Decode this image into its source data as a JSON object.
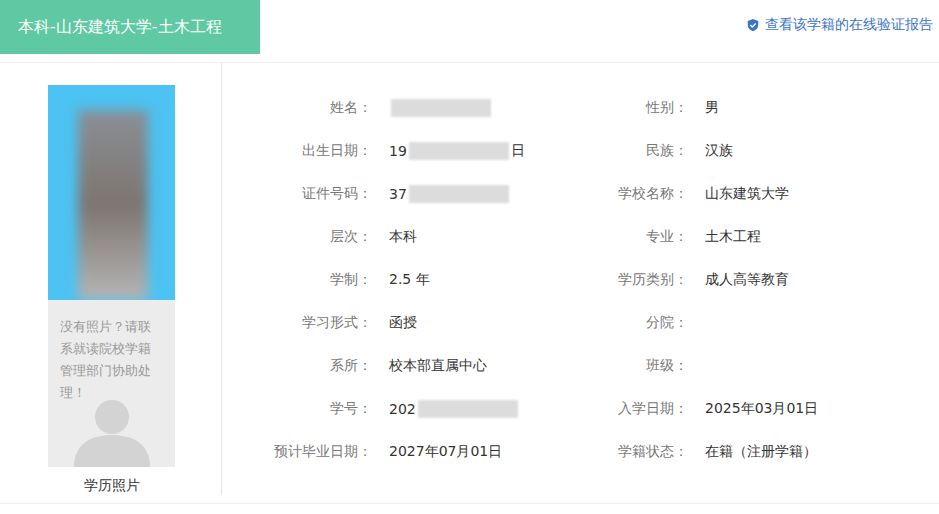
{
  "header": {
    "title": "本科-山东建筑大学-土木工程",
    "verify_link": "查看该学籍的在线验证报告"
  },
  "photo": {
    "placeholder": "没有照片？请联系就读院校学籍管理部门协助处理！",
    "caption": "学历照片"
  },
  "fields": [
    {
      "label": "姓名：",
      "value": "",
      "masked": true,
      "tail": ""
    },
    {
      "label": "性别：",
      "value": "男",
      "masked": false,
      "tail": ""
    },
    {
      "label": "出生日期：",
      "value": "19",
      "masked": true,
      "tail": "日"
    },
    {
      "label": "民族：",
      "value": "汉族",
      "masked": false,
      "tail": ""
    },
    {
      "label": "证件号码：",
      "value": "37",
      "masked": true,
      "tail": ""
    },
    {
      "label": "学校名称：",
      "value": "山东建筑大学",
      "masked": false,
      "tail": ""
    },
    {
      "label": "层次：",
      "value": "本科",
      "masked": false,
      "tail": ""
    },
    {
      "label": "专业：",
      "value": "土木工程",
      "masked": false,
      "tail": ""
    },
    {
      "label": "学制：",
      "value": "2.5 年",
      "masked": false,
      "tail": ""
    },
    {
      "label": "学历类别：",
      "value": "成人高等教育",
      "masked": false,
      "tail": ""
    },
    {
      "label": "学习形式：",
      "value": "函授",
      "masked": false,
      "tail": ""
    },
    {
      "label": "分院：",
      "value": "",
      "masked": false,
      "tail": ""
    },
    {
      "label": "系所：",
      "value": "校本部直属中心",
      "masked": false,
      "tail": ""
    },
    {
      "label": "班级：",
      "value": "",
      "masked": false,
      "tail": ""
    },
    {
      "label": "学号：",
      "value": "202",
      "masked": true,
      "tail": ""
    },
    {
      "label": "入学日期：",
      "value": "2025年03月01日",
      "masked": false,
      "tail": ""
    },
    {
      "label": "预计毕业日期：",
      "value": "2027年07月01日",
      "masked": false,
      "tail": ""
    },
    {
      "label": "学籍状态：",
      "value": "在籍（注册学籍）",
      "masked": false,
      "tail": ""
    }
  ]
}
